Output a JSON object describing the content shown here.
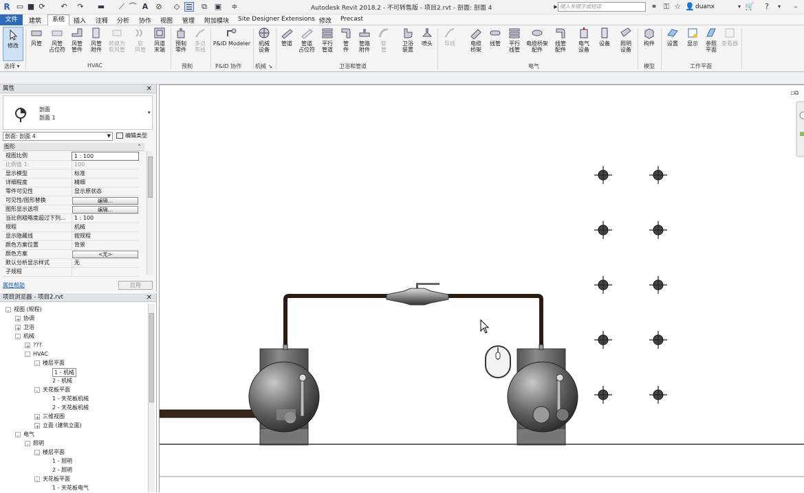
{
  "titlebar": {
    "title": "Autodesk Revit 2018.2 - 不可转售版 -   项目2.rvt - 剖面: 剖面 4",
    "search_placeholder": "键入关键字或短语",
    "user": "duanx"
  },
  "menus": [
    "文件",
    "建筑",
    "系统",
    "插入",
    "注释",
    "分析",
    "协作",
    "视图",
    "管理",
    "附加模块",
    "Site Designer",
    "Extensions",
    "修改",
    "Precast"
  ],
  "ribbon": {
    "modify": "修改",
    "select": "选择",
    "hvac": [
      "风管",
      "风管\n占位符",
      "风管\n管件",
      "风管\n附件",
      "转换为\n软风管",
      "软\n风管",
      "风道\n末端"
    ],
    "fab": [
      "预制\n零件",
      "多点\n布线"
    ],
    "pid": "P&ID Modeler",
    "mech": "机械\n设备",
    "plumb": [
      "管道",
      "管道\n占位符",
      "平行\n管道",
      "管\n件",
      "管路\n附件",
      "软\n管",
      "卫浴\n装置",
      "喷头"
    ],
    "elec": [
      "导线",
      "电缆\n桥架",
      "线管",
      "平行\n线管",
      "电缆桥架\n配件",
      "线管\n配件",
      "电气\n设备",
      "设备",
      "照明\n设备"
    ],
    "model": "构件",
    "work": [
      "设置",
      "显示",
      "参照\n平面",
      "查看器"
    ],
    "groups": [
      "选择 ▾",
      "HVAC",
      "预制",
      "P&ID 协作",
      "机械 ↘",
      "卫浴和管道",
      "电气",
      "模型",
      "工作平面"
    ]
  },
  "properties": {
    "title": "属性",
    "type_line1": "剖面",
    "type_line2": "剖面 1",
    "instance": "剖面: 剖面 4",
    "edit_type": "编辑类型",
    "section": "图形",
    "rows": [
      {
        "k": "视图比例",
        "v": "1 : 100"
      },
      {
        "k": "比例值 1:",
        "v": "100"
      },
      {
        "k": "显示模型",
        "v": "标准"
      },
      {
        "k": "详细程度",
        "v": "精细"
      },
      {
        "k": "零件可见性",
        "v": "显示原状态"
      },
      {
        "k": "可见性/图形替换",
        "v": "编辑..."
      },
      {
        "k": "图形显示选项",
        "v": "编辑..."
      },
      {
        "k": "当比例粗略度超过下列...",
        "v": "1 : 100"
      },
      {
        "k": "规程",
        "v": "机械"
      },
      {
        "k": "显示隐藏线",
        "v": "按规程"
      },
      {
        "k": "颜色方案位置",
        "v": "背景"
      },
      {
        "k": "颜色方案",
        "v": "<无>"
      },
      {
        "k": "默认分析显示样式",
        "v": "无"
      },
      {
        "k": "子规程",
        "v": ""
      }
    ],
    "help": "属性帮助",
    "apply": "应用"
  },
  "browser": {
    "title": "项目浏览器 - 项目2.rvt",
    "items": [
      "视图 (规程)",
      "协调",
      "卫浴",
      "机械",
      "???",
      "HVAC",
      "楼层平面",
      "1 - 机械",
      "2 - 机械",
      "天花板平面",
      "1 - 天花板机械",
      "2 - 天花板机械",
      "三维视图",
      "立面 (建筑立面)",
      "电气",
      "照明",
      "楼层平面",
      "1 - 照明",
      "2 - 照明",
      "天花板平面",
      "1 - 天花板电气"
    ]
  }
}
